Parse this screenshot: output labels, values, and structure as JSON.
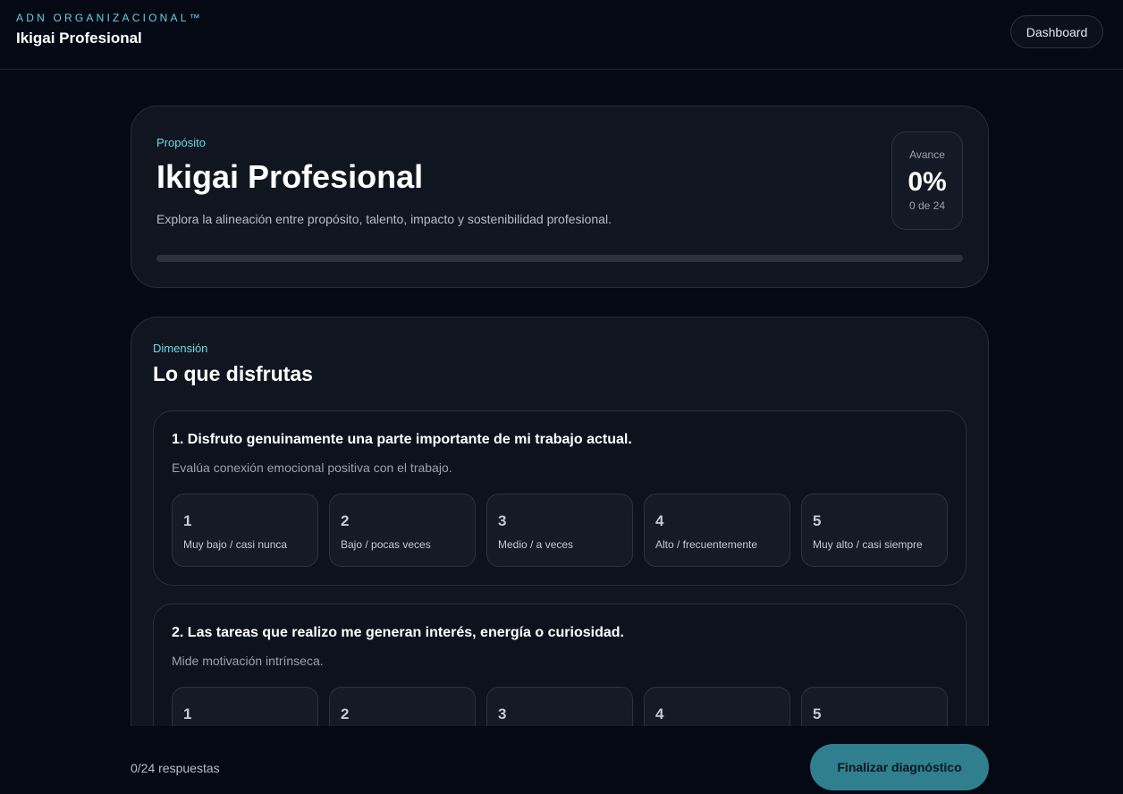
{
  "header": {
    "brand": "ADN ORGANIZACIONAL™",
    "title": "Ikigai Profesional",
    "dashboard_label": "Dashboard"
  },
  "hero": {
    "eyebrow": "Propósito",
    "title": "Ikigai Profesional",
    "description": "Explora la alineación entre propósito, talento, impacto y sostenibilidad profesional.",
    "progress_label": "Avance",
    "progress_percent": "0%",
    "progress_count": "0 de 24",
    "progress_value": 0
  },
  "dimension": {
    "eyebrow": "Dimensión",
    "title": "Lo que disfrutas"
  },
  "questions": [
    {
      "text": "1. Disfruto genuinamente una parte importante de mi trabajo actual.",
      "help": "Evalúa conexión emocional positiva con el trabajo."
    },
    {
      "text": "2. Las tareas que realizo me generan interés, energía o curiosidad.",
      "help": "Mide motivación intrínseca."
    }
  ],
  "scale": [
    {
      "value": "1",
      "label": "Muy bajo / casi nunca"
    },
    {
      "value": "2",
      "label": "Bajo / pocas veces"
    },
    {
      "value": "3",
      "label": "Medio / a veces"
    },
    {
      "value": "4",
      "label": "Alto / frecuentemente"
    },
    {
      "value": "5",
      "label": "Muy alto / casi siempre"
    }
  ],
  "footer": {
    "answered": "0/24 respuestas",
    "finish_label": "Finalizar diagnóstico"
  },
  "colors": {
    "accent": "#63d4e4",
    "button": "#2f7f8f",
    "background": "#050914"
  }
}
